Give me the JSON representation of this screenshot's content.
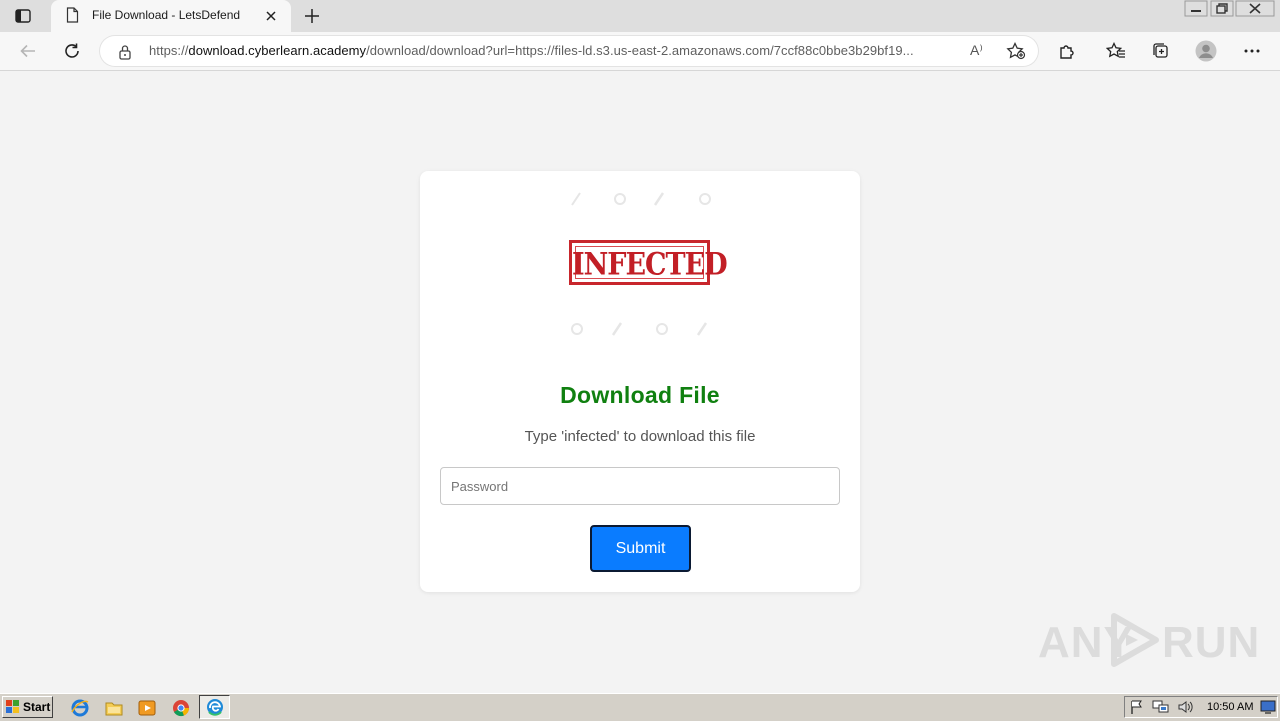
{
  "browser": {
    "tab_title": "File Download - LetsDefend",
    "url_prefix": "https://",
    "url_host": "download.cyberlearn.academy",
    "url_rest": "/download/download?url=https://files-ld.s3.us-east-2.amazonaws.com/7ccf88c0bbe3b29bf19...",
    "read_aloud_label": "A⁾"
  },
  "card": {
    "stamp_text": "INFECTED",
    "heading": "Download File",
    "hint": "Type 'infected' to download this file",
    "password_placeholder": "Password",
    "password_value": "",
    "submit_label": "Submit"
  },
  "watermark": {
    "text_left": "ANY",
    "text_right": "RUN"
  },
  "taskbar": {
    "start_label": "Start",
    "clock": "10:50 AM"
  },
  "colors": {
    "heading": "#108010",
    "submit_bg": "#0a7cff",
    "stamp_red": "#c21f26"
  }
}
